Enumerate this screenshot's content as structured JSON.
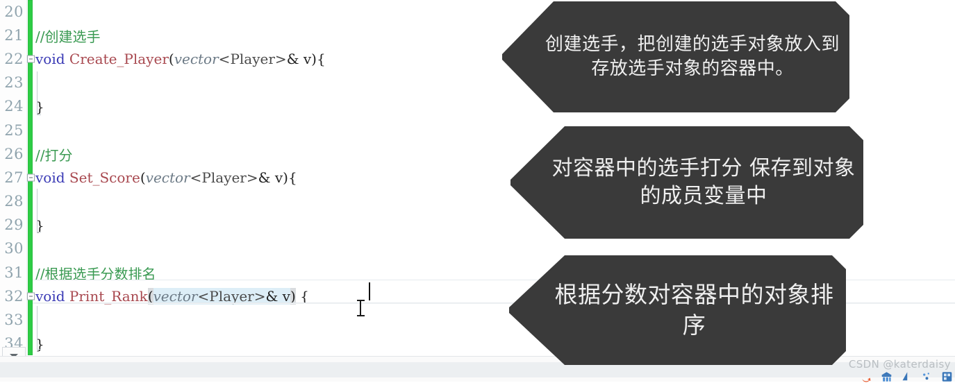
{
  "editor": {
    "gutter_first_line": 20,
    "change_marker_color": "#2ecc45",
    "scroll_button_icon": "chevron-down-icon",
    "lines": [
      {
        "num": "20",
        "type": "blank",
        "text": ""
      },
      {
        "num": "21",
        "type": "comment",
        "text": "//创建选手"
      },
      {
        "num": "22",
        "type": "signature",
        "keyword": "void",
        "func": "Create_Player",
        "open_paren": "(",
        "param_type": "vector",
        "lt": "<",
        "param_class": "Player",
        "gt": ">",
        "amp": "& ",
        "param_name": "v",
        "close_paren": ")",
        "brace": "{"
      },
      {
        "num": "23",
        "type": "blank",
        "text": ""
      },
      {
        "num": "24",
        "type": "brace",
        "text": "}"
      },
      {
        "num": "25",
        "type": "blank",
        "text": ""
      },
      {
        "num": "26",
        "type": "comment",
        "text": "//打分"
      },
      {
        "num": "27",
        "type": "signature",
        "keyword": "void",
        "func": "Set_Score",
        "open_paren": "(",
        "param_type": "vector",
        "lt": "<",
        "param_class": "Player",
        "gt": ">",
        "amp": "& ",
        "param_name": "v",
        "close_paren": ")",
        "brace": "{"
      },
      {
        "num": "28",
        "type": "blank",
        "text": ""
      },
      {
        "num": "29",
        "type": "brace",
        "text": "}"
      },
      {
        "num": "30",
        "type": "blank",
        "text": ""
      },
      {
        "num": "31",
        "type": "comment",
        "text": "//根据选手分数排名"
      },
      {
        "num": "32",
        "type": "signature-active",
        "keyword": "void",
        "func": "Print_Rank",
        "open_paren": "(",
        "param_type": "vector",
        "lt": "<",
        "param_class": "Player",
        "gt": ">",
        "amp": "& ",
        "param_name": "v",
        "close_paren": ")",
        "brace": "{"
      },
      {
        "num": "33",
        "type": "blank",
        "text": ""
      },
      {
        "num": "34",
        "type": "brace",
        "text": "}"
      }
    ],
    "syntax_colors": {
      "comment": "#3a9a52",
      "keyword": "#3a3ab5",
      "function": "#a8484f",
      "type_italic": "#6c7a86",
      "class": "#4a4a4a",
      "plain": "#222222",
      "selection": "#ddeef7",
      "brace_match": "#d9dcdf"
    }
  },
  "callouts": [
    {
      "id": "callout-1",
      "text": "创建选手，把创建的选手对象放入到存放选手对象的容器中。",
      "bg": "#3a3a3a",
      "fg": "#efefef"
    },
    {
      "id": "callout-2",
      "text": "对容器中的选手打分 保存到对象的成员变量中",
      "bg": "#3a3a3a",
      "fg": "#efefef"
    },
    {
      "id": "callout-3",
      "text": "根据分数对容器中的对象排序",
      "bg": "#3a3a3a",
      "fg": "#efefef"
    }
  ],
  "watermark": {
    "text": "CSDN @katerdaisy"
  }
}
